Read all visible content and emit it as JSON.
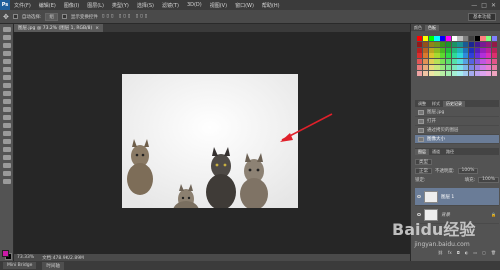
{
  "app": {
    "logo": "Ps"
  },
  "menu": [
    "文件(F)",
    "编辑(E)",
    "图像(I)",
    "图层(L)",
    "类型(Y)",
    "选择(S)",
    "滤镜(T)",
    "3D(D)",
    "视图(V)",
    "窗口(W)",
    "帮助(H)"
  ],
  "window_buttons": [
    "—",
    "□",
    "✕"
  ],
  "options_bar": {
    "auto_select_label": "自动选择:",
    "layer_value": "组",
    "transform_label": "显示变换控件",
    "workspace": "基本功能"
  },
  "document_tab": {
    "title": "图层.jpg @ 73.2% (图层 1, RGB/8)",
    "close": "×"
  },
  "status_bar": {
    "zoom": "73.33%",
    "doc_info": "文档:478.9K/2.89M"
  },
  "mini_bridge": {
    "tabs": [
      "Mini Bridge",
      "时间轴"
    ]
  },
  "panels": {
    "top_tabs": [
      "颜色",
      "色板"
    ],
    "history_tabs": [
      "调整",
      "样式",
      "历史记录"
    ],
    "history_items": [
      {
        "label": "图层.jpg",
        "selected": false
      },
      {
        "label": "打开",
        "selected": false
      },
      {
        "label": "通过拷贝的图层",
        "selected": false
      },
      {
        "label": "图像大小",
        "selected": true
      }
    ],
    "layers_tabs": [
      "图层",
      "通道",
      "路径"
    ],
    "layer_controls": {
      "kind": "类型",
      "blend": "正常",
      "opacity_label": "不透明度:",
      "opacity_value": "100%",
      "lock_label": "锁定:",
      "fill_label": "填充:",
      "fill_value": "100%"
    },
    "layers": [
      {
        "name": "图层 1",
        "selected": true
      },
      {
        "name": "背景",
        "selected": false
      }
    ],
    "footer_icons": [
      "link-icon",
      "fx-icon",
      "mask-icon",
      "adjust-icon",
      "folder-icon",
      "new-layer-icon",
      "trash-icon"
    ]
  },
  "colors": {
    "foreground": "#cc1aa8",
    "background": "#000000",
    "arrow": "#e0202a",
    "selection": "#6a7c97"
  },
  "watermark": {
    "main": "Baidu经验",
    "sub": "jingyan.baidu.com"
  }
}
